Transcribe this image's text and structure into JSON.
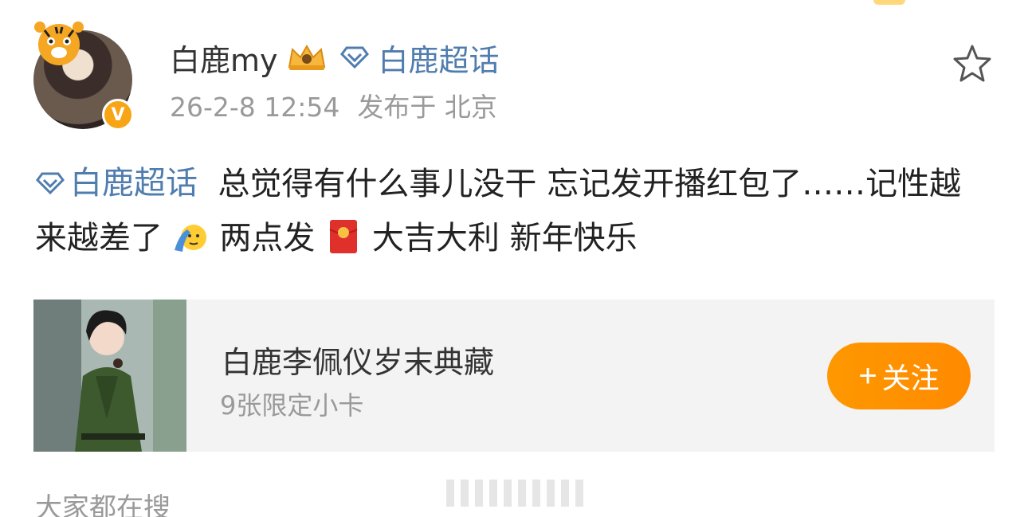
{
  "header": {
    "username": "白鹿my",
    "topic_link": "白鹿超话",
    "timestamp": "26-2-8 12:54",
    "location": "发布于 北京",
    "vip_badge": "V"
  },
  "content": {
    "topic": "白鹿超话",
    "text_1": "总觉得有什么事儿没干 忘记发开播红包了……记性越来越差了",
    "text_2": "两点发",
    "text_3": "大吉大利 新年快乐"
  },
  "card": {
    "title": "白鹿李佩仪岁末典藏",
    "subtitle": "9张限定小卡",
    "follow_plus": "+",
    "follow_label": "关注"
  },
  "footer": {
    "hot_search_label": "大家都在搜"
  },
  "colors": {
    "link_blue": "#507daf",
    "accent_orange": "#ff8a00",
    "muted_gray": "#9a9a9a"
  },
  "icons": [
    "tiger-icon",
    "vip-badge-icon",
    "crown-icon",
    "diamond-icon",
    "star-icon",
    "salute-emoji-icon",
    "red-envelope-icon"
  ]
}
